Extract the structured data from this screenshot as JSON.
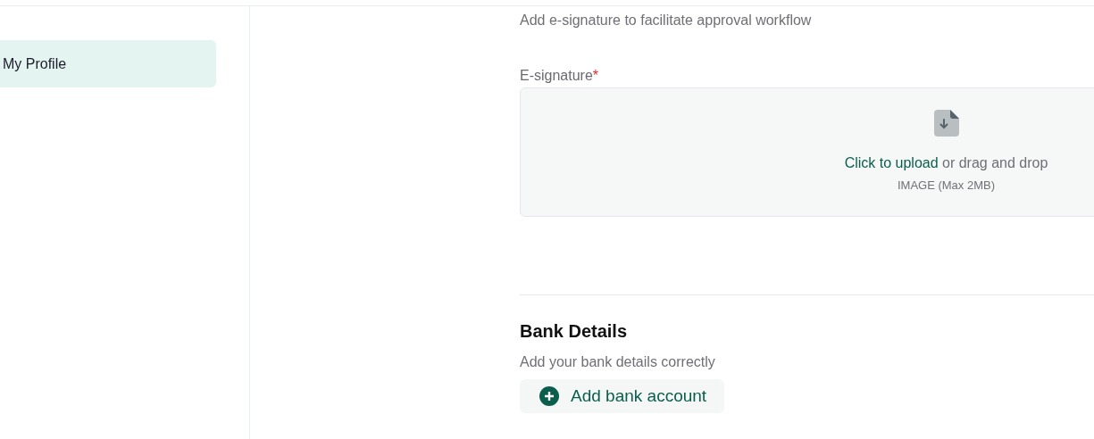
{
  "sidebar": {
    "items": [
      {
        "label": "My Profile",
        "selected": true
      }
    ]
  },
  "signature": {
    "description": "Add e-signature to facilitate approval workflow",
    "label": "E-signature",
    "required_mark": "*",
    "upload": {
      "link": "Click to upload",
      "text": " or drag and drop",
      "hint": "IMAGE (Max 2MB)"
    }
  },
  "bank": {
    "title": "Bank Details",
    "description": "Add your bank details correctly",
    "add_button": "Add bank account"
  }
}
